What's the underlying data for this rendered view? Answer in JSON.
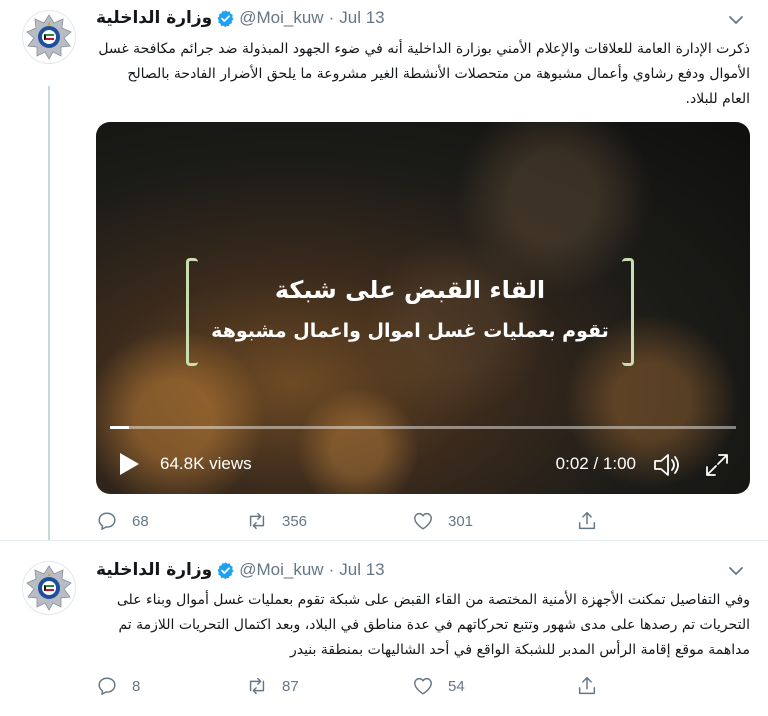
{
  "tweets": [
    {
      "author": {
        "name": "وزارة الداخلية",
        "handle": "@Moi_kuw",
        "verified": true
      },
      "dot": "·",
      "date": "Jul 13",
      "text": "ذكرت الإدارة العامة للعلاقات والإعلام الأمني بوزارة الداخلية أنه في ضوء الجهود المبذولة ضد جرائم مكافحة غسل الأموال ودفع رشاوي وأعمال مشبوهة من متحصلات الأنشطة الغير مشروعة ما يلحق الأضرار الفادحة بالصالح العام للبلاد.",
      "video": {
        "overlay_title": "القاء القبض على شبكة",
        "overlay_subtitle": "تقوم بعمليات غسل اموال واعمال مشبوهة",
        "views": "64.8K views",
        "time": "0:02 / 1:00",
        "progress": 0.03
      },
      "stats": {
        "replies": "68",
        "retweets": "356",
        "likes": "301"
      }
    },
    {
      "author": {
        "name": "وزارة الداخلية",
        "handle": "@Moi_kuw",
        "verified": true
      },
      "dot": "·",
      "date": "Jul 13",
      "text": "وفي التفاصيل تمكنت الأجهزة الأمنية المختصة من القاء القبض على شبكة تقوم بعمليات غسل أموال وبناء على التحريات تم رصدها على مدى شهور وتتبع تحركاتهم في عدة مناطق في البلاد، وبعد اكتمال التحريات اللازمة تم مداهمة موقع إقامة الرأس المدبر للشبكة الواقع في أحد الشاليهات بمنطقة بنيدر",
      "stats": {
        "replies": "8",
        "retweets": "87",
        "likes": "54"
      }
    }
  ],
  "colors": {
    "verified": "#1da1f2",
    "muted": "#657786",
    "text": "#14171a",
    "divider": "#e6ecf0"
  },
  "icons": [
    "chevron-down-icon",
    "verified-badge-icon",
    "reply-icon",
    "retweet-icon",
    "like-icon",
    "share-icon",
    "play-icon",
    "volume-icon",
    "fullscreen-icon",
    "police-emblem-icon"
  ]
}
